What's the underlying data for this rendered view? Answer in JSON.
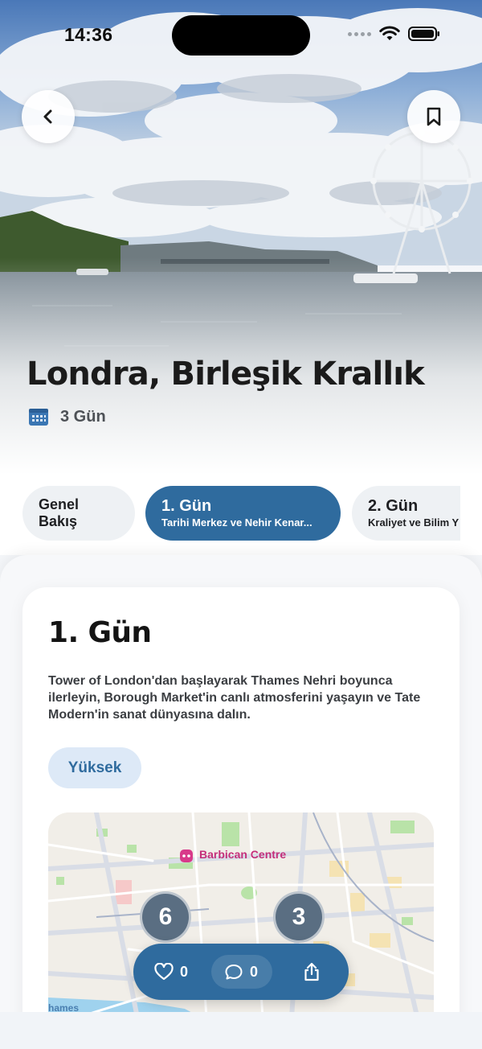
{
  "status": {
    "time": "14:36"
  },
  "hero": {
    "title": "Londra, Birleşik Krallık",
    "duration": "3 Gün"
  },
  "tabs": {
    "overview": "Genel Bakış",
    "days": [
      {
        "title": "1. Gün",
        "subtitle": "Tarihi Merkez ve Nehir Kenar..."
      },
      {
        "title": "2. Gün",
        "subtitle": "Kraliyet ve Bilim Y"
      }
    ]
  },
  "day": {
    "title": "1. Gün",
    "description": "Tower of London'dan başlayarak Thames Nehri boyunca ilerleyin, Borough Market'in canlı atmosferini yaşayın ve Tate Modern'in sanat dünyasına dalın.",
    "badge": "Yüksek"
  },
  "map": {
    "poi_label": "Barbican Centre",
    "water_label": "hames",
    "markers": [
      "6",
      "3"
    ]
  },
  "actions": {
    "likes": "0",
    "comments": "0"
  },
  "colors": {
    "accent": "#2f6b9e",
    "badge_bg": "#dde9f7",
    "marker": "#5a6e82"
  },
  "icons": [
    "back-icon",
    "bookmark-icon",
    "calendar-icon",
    "heart-icon",
    "comment-icon",
    "share-icon",
    "wifi-icon",
    "battery-icon"
  ]
}
